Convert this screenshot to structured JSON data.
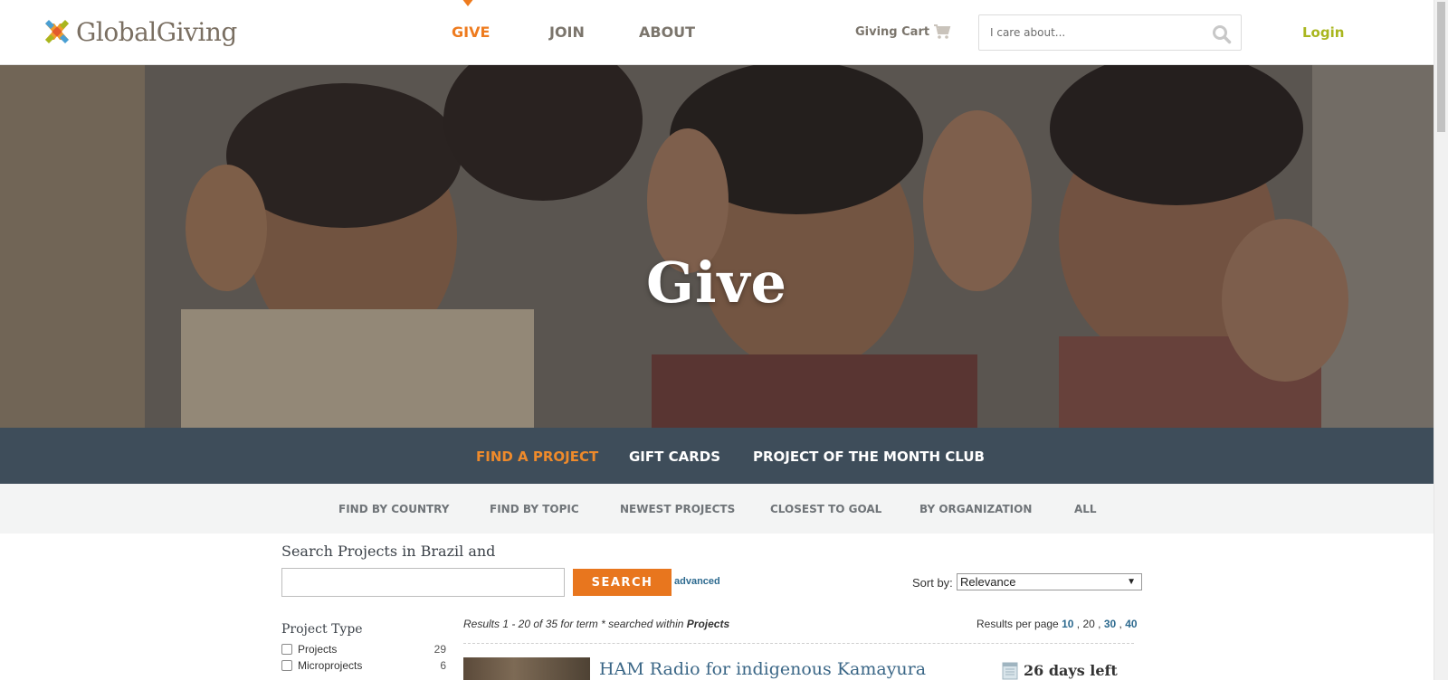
{
  "header": {
    "logo_text": "GlobalGiving",
    "nav": [
      "GIVE",
      "JOIN",
      "ABOUT"
    ],
    "cart_label": "Giving Cart",
    "search_placeholder": "I care about...",
    "login_label": "Login"
  },
  "hero": {
    "title": "Give"
  },
  "subnav": [
    "FIND A PROJECT",
    "GIFT CARDS",
    "PROJECT OF THE MONTH CLUB"
  ],
  "filternav": [
    "FIND BY COUNTRY",
    "FIND BY TOPIC",
    "NEWEST PROJECTS",
    "CLOSEST TO GOAL",
    "BY ORGANIZATION",
    "ALL"
  ],
  "search": {
    "heading": "Search Projects in Brazil and",
    "button_label": "SEARCH",
    "advanced_label": "advanced",
    "sort_label": "Sort by:",
    "sort_value": "Relevance"
  },
  "sidebar": {
    "title": "Project Type",
    "facets": [
      {
        "label": "Projects",
        "count": "29"
      },
      {
        "label": "Microprojects",
        "count": "6"
      }
    ]
  },
  "results": {
    "info_prefix": "Results 1 - 20 of 35 for term * searched within ",
    "info_scope": "Projects",
    "per_page_label": "Results per page",
    "per_page_options": [
      "10",
      "20",
      "30",
      "40"
    ],
    "first_project_title": "HAM Radio for indigenous Kamayura",
    "first_project_days": "26 days left"
  },
  "colors": {
    "accent_orange": "#ee7b1e",
    "login_green": "#a9b61e",
    "subnav_bg": "#3e4d5a",
    "link_blue": "#2d6a8f"
  }
}
